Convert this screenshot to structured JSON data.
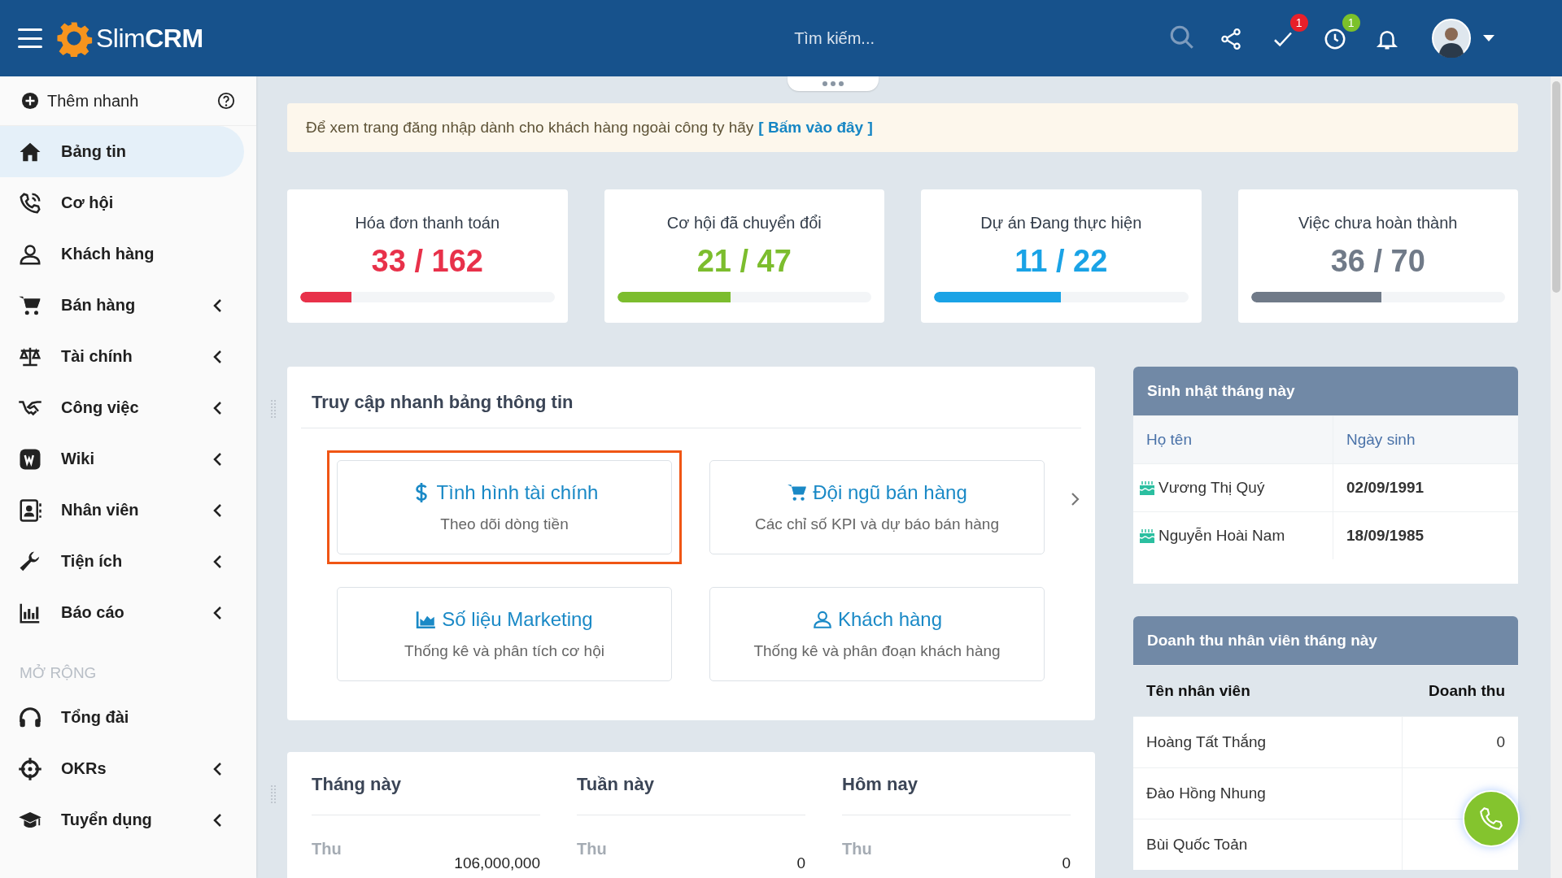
{
  "header": {
    "logo": "Slim**CRM**",
    "search": {
      "placeholder": "Tìm kiếm..."
    },
    "actions": [
      {
        "kind": "share"
      },
      {
        "kind": "tasks",
        "badge": "1",
        "color": "#e8202a"
      },
      {
        "kind": "clock",
        "badge": "1",
        "color": "#7cc12b"
      },
      {
        "kind": "bell"
      }
    ]
  },
  "sidebar": {
    "quick_add": {
      "label": "Thêm nhanh"
    },
    "items": [
      {
        "kind": "home",
        "label": "Bảng tin",
        "selected": true,
        "has_submenu": false
      },
      {
        "kind": "phone",
        "label": "Cơ hội",
        "selected": false,
        "has_submenu": false
      },
      {
        "kind": "user",
        "label": "Khách hàng",
        "selected": false,
        "has_submenu": false
      },
      {
        "kind": "cart",
        "label": "Bán hàng",
        "selected": false,
        "has_submenu": true
      },
      {
        "kind": "scale",
        "label": "Tài chính",
        "selected": false,
        "has_submenu": true
      },
      {
        "kind": "handshake",
        "label": "Công việc",
        "selected": false,
        "has_submenu": true
      },
      {
        "kind": "wiki",
        "label": "Wiki",
        "selected": false,
        "has_submenu": true
      },
      {
        "kind": "contact",
        "label": "Nhân viên",
        "selected": false,
        "has_submenu": true
      },
      {
        "kind": "wrench",
        "label": "Tiện ích",
        "selected": false,
        "has_submenu": true
      },
      {
        "kind": "chart",
        "label": "Báo cáo",
        "selected": false,
        "has_submenu": true
      }
    ],
    "section_title": "MỞ RỘNG",
    "extra_items": [
      {
        "kind": "headset",
        "label": "Tổng đài",
        "selected": false,
        "has_submenu": false
      },
      {
        "kind": "target",
        "label": "OKRs",
        "selected": false,
        "has_submenu": true
      },
      {
        "kind": "graduation",
        "label": "Tuyển dụng",
        "selected": false,
        "has_submenu": true
      }
    ]
  },
  "notice": {
    "text": "Để xem trang đăng nhập dành cho khách hàng ngoài công ty hãy",
    "link": "[ Bấm vào đây ]"
  },
  "stats": [
    {
      "title": "Hóa đơn thanh toán",
      "value": "33 / 162",
      "level": 0.2,
      "color": "#e8314a"
    },
    {
      "title": "Cơ hội đã chuyển đổi",
      "value": "21 / 47",
      "level": 0.447,
      "color": "#7cbd2e"
    },
    {
      "title": "Dự án Đang thực hiện",
      "value": "11 / 22",
      "level": 0.5,
      "color": "#1aa3e6"
    },
    {
      "title": "Việc chưa hoàn thành",
      "value": "36 / 70",
      "level": 0.514,
      "color": "#707a88"
    }
  ],
  "quick_access": {
    "title": "Truy cập nhanh bảng thông tin",
    "tiles": [
      {
        "kind": "dollar",
        "title": "Tình hình tài chính",
        "subtitle": "Theo dõi dòng tiền",
        "highlighted": true
      },
      {
        "kind": "cart",
        "title": "Đội ngũ bán hàng",
        "subtitle": "Các chỉ số KPI và dự báo bán hàng",
        "highlighted": false
      },
      {
        "kind": "area",
        "title": "Số liệu Marketing",
        "subtitle": "Thống kê và phân tích cơ hội",
        "highlighted": false
      },
      {
        "kind": "user",
        "title": "Khách hàng",
        "subtitle": "Thống kê và phân đoạn khách hàng",
        "highlighted": false
      }
    ]
  },
  "birthdays": {
    "title": "Sinh nhật tháng này",
    "columns": [
      "Họ tên",
      "Ngày sinh"
    ],
    "rows": [
      [
        "Vương Thị Quý",
        "02/09/1991"
      ],
      [
        "Nguyễn Hoài Nam",
        "18/09/1985"
      ]
    ]
  },
  "revenue": {
    "title": "Doanh thu nhân viên tháng này",
    "columns": [
      "Tên nhân viên",
      "Doanh thu"
    ],
    "rows": [
      [
        "Hoàng Tất Thắng",
        "0"
      ],
      [
        "Đào Hồng Nhung"
      ],
      [
        "Bùi Quốc Toản"
      ]
    ]
  },
  "periods": [
    {
      "title": "Tháng này",
      "rows": [
        {
          "label": "Thu",
          "value": "106,000,000"
        }
      ]
    },
    {
      "title": "Tuần này",
      "rows": [
        {
          "label": "Thu",
          "value": "0"
        }
      ]
    },
    {
      "title": "Hôm nay",
      "rows": [
        {
          "label": "Thu",
          "value": "0"
        }
      ]
    }
  ]
}
